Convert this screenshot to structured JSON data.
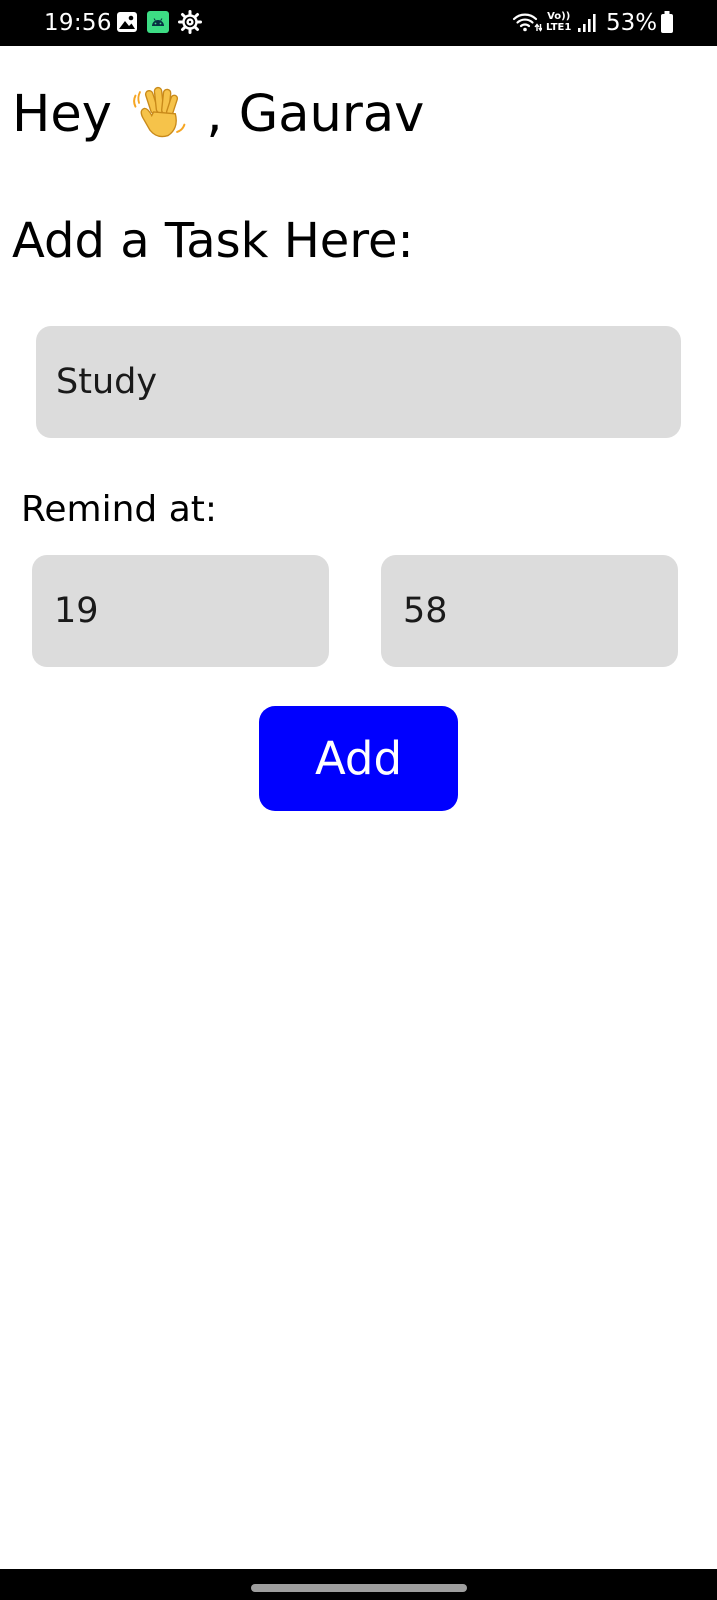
{
  "status_bar": {
    "time": "19:56",
    "battery_percent": "53%",
    "network_label_top": "Vo))",
    "network_label_bottom": "LTE1",
    "left_icons": [
      "gallery-icon",
      "android-icon",
      "settings-icon"
    ],
    "right_icons": [
      "wifi-icon",
      "volte-icon",
      "signal-icon",
      "battery-icon"
    ]
  },
  "greeting": {
    "prefix": "Hey",
    "emoji": "👋",
    "name_part": ", Gaurav"
  },
  "task_form": {
    "heading": "Add a Task Here:",
    "task_value": "Study",
    "remind_label": "Remind at:",
    "hour_value": "19",
    "minute_value": "58",
    "add_label": "Add"
  },
  "colors": {
    "add_button": "#0000ff",
    "input_background": "#dcdcdc",
    "status_bar": "#000000"
  }
}
